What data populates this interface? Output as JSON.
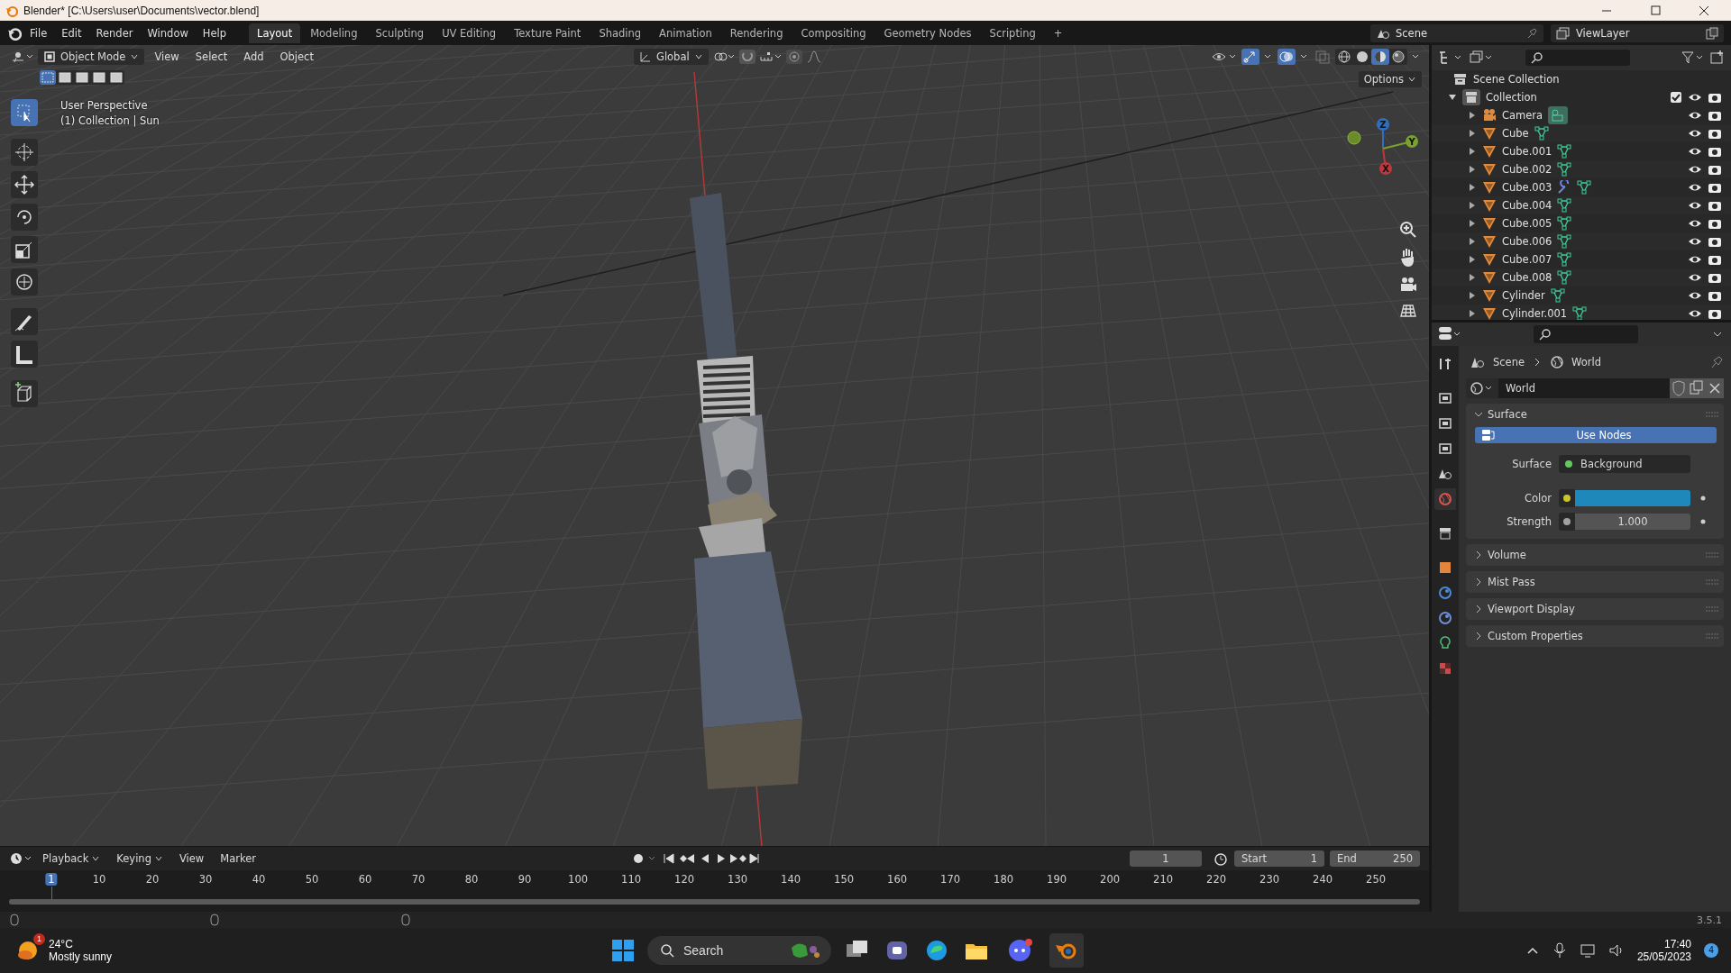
{
  "window": {
    "title": "Blender* [C:\\Users\\user\\Documents\\vector.blend]"
  },
  "menu": [
    "File",
    "Edit",
    "Render",
    "Window",
    "Help"
  ],
  "workspaces": [
    {
      "label": "Layout",
      "selected": true
    },
    {
      "label": "Modeling",
      "selected": false
    },
    {
      "label": "Sculpting",
      "selected": false
    },
    {
      "label": "UV Editing",
      "selected": false
    },
    {
      "label": "Texture Paint",
      "selected": false
    },
    {
      "label": "Shading",
      "selected": false
    },
    {
      "label": "Animation",
      "selected": false
    },
    {
      "label": "Rendering",
      "selected": false
    },
    {
      "label": "Compositing",
      "selected": false
    },
    {
      "label": "Geometry Nodes",
      "selected": false
    },
    {
      "label": "Scripting",
      "selected": false
    }
  ],
  "add_workspace": "+",
  "scene": "Scene",
  "view_layer": "ViewLayer",
  "viewport": {
    "mode": "Object Mode",
    "menus": [
      "View",
      "Select",
      "Add",
      "Object"
    ],
    "orientation": "Global",
    "options": "Options",
    "overlay_text": [
      "User Perspective",
      "(1) Collection | Sun"
    ],
    "shading": [
      {
        "kind": "wireframe",
        "selected": false
      },
      {
        "kind": "solid",
        "selected": false
      },
      {
        "kind": "material",
        "selected": true
      },
      {
        "kind": "rendered",
        "selected": false
      }
    ],
    "tools": [
      {
        "kind": "select",
        "selected": true
      },
      {
        "kind": "cursor",
        "selected": false
      },
      {
        "kind": "move",
        "selected": false
      },
      {
        "kind": "rotate",
        "selected": false
      },
      {
        "kind": "scale",
        "selected": false
      },
      {
        "kind": "transform",
        "selected": false
      },
      {
        "kind": "annotate",
        "selected": false
      },
      {
        "kind": "measure",
        "selected": false
      },
      {
        "kind": "add_cube",
        "selected": false
      }
    ],
    "axes": [
      "Z",
      "Y",
      "X"
    ]
  },
  "outliner": {
    "root": "Scene Collection",
    "collection": {
      "name": "Collection",
      "expanded": true,
      "checked": true,
      "children": [
        {
          "name": "Camera",
          "kind": "camera",
          "data": [
            {
              "kind": "camera_data"
            }
          ]
        },
        {
          "name": "Cube",
          "kind": "mesh",
          "data": [
            {
              "kind": "mesh_data"
            }
          ]
        },
        {
          "name": "Cube.001",
          "kind": "mesh",
          "data": [
            {
              "kind": "mesh_data"
            }
          ]
        },
        {
          "name": "Cube.002",
          "kind": "mesh",
          "data": [
            {
              "kind": "mesh_data"
            }
          ]
        },
        {
          "name": "Cube.003",
          "kind": "mesh",
          "data": [
            {
              "kind": "modifier"
            },
            {
              "kind": "mesh_data"
            }
          ]
        },
        {
          "name": "Cube.004",
          "kind": "mesh",
          "data": [
            {
              "kind": "mesh_data"
            }
          ]
        },
        {
          "name": "Cube.005",
          "kind": "mesh",
          "data": [
            {
              "kind": "mesh_data"
            }
          ]
        },
        {
          "name": "Cube.006",
          "kind": "mesh",
          "data": [
            {
              "kind": "mesh_data"
            }
          ]
        },
        {
          "name": "Cube.007",
          "kind": "mesh",
          "data": [
            {
              "kind": "mesh_data"
            }
          ]
        },
        {
          "name": "Cube.008",
          "kind": "mesh",
          "data": [
            {
              "kind": "mesh_data"
            }
          ]
        },
        {
          "name": "Cylinder",
          "kind": "mesh",
          "data": [
            {
              "kind": "mesh_data"
            }
          ]
        },
        {
          "name": "Cylinder.001",
          "kind": "mesh",
          "data": [
            {
              "kind": "mesh_data"
            }
          ]
        }
      ]
    }
  },
  "properties": {
    "tabs": [
      {
        "kind": "tool",
        "selected": false
      },
      {
        "kind": "render",
        "selected": false
      },
      {
        "kind": "output",
        "selected": false
      },
      {
        "kind": "view_layer",
        "selected": false
      },
      {
        "kind": "scene",
        "selected": false
      },
      {
        "kind": "world",
        "selected": true
      },
      {
        "kind": "collection",
        "selected": false
      },
      {
        "kind": "object",
        "selected": false
      },
      {
        "kind": "physics",
        "selected": false
      },
      {
        "kind": "constraints",
        "selected": false
      },
      {
        "kind": "data",
        "selected": false
      },
      {
        "kind": "texture",
        "selected": false
      }
    ],
    "breadcrumb": [
      "Scene",
      "World"
    ],
    "world_name": "World",
    "panels": [
      {
        "title": "Surface",
        "expanded": true
      },
      {
        "title": "Volume",
        "expanded": false
      },
      {
        "title": "Mist Pass",
        "expanded": false
      },
      {
        "title": "Viewport Display",
        "expanded": false
      },
      {
        "title": "Custom Properties",
        "expanded": false
      }
    ],
    "use_nodes": "Use Nodes",
    "fields": [
      {
        "label": "Surface",
        "kind": "shader",
        "value": "Background"
      },
      {
        "label": "Color",
        "kind": "color",
        "color": "#1f88ba"
      },
      {
        "label": "Strength",
        "kind": "number",
        "value": "1.000"
      }
    ]
  },
  "timeline": {
    "menus": [
      "Playback",
      "Keying",
      "View",
      "Marker"
    ],
    "current_frame": "1",
    "start_label": "Start",
    "start": "1",
    "end_label": "End",
    "end": "250",
    "ruler": [
      "1",
      "10",
      "20",
      "30",
      "40",
      "50",
      "60",
      "70",
      "80",
      "90",
      "100",
      "110",
      "120",
      "130",
      "140",
      "150",
      "160",
      "170",
      "180",
      "190",
      "200",
      "210",
      "220",
      "230",
      "240",
      "250"
    ]
  },
  "status_bar": {
    "version": "3.5.1"
  },
  "taskbar": {
    "weather_badge": "1",
    "temperature": "24°C",
    "weather": "Mostly sunny",
    "search": "Search",
    "time": "17:40",
    "date": "25/05/2023",
    "notifications": "4"
  }
}
